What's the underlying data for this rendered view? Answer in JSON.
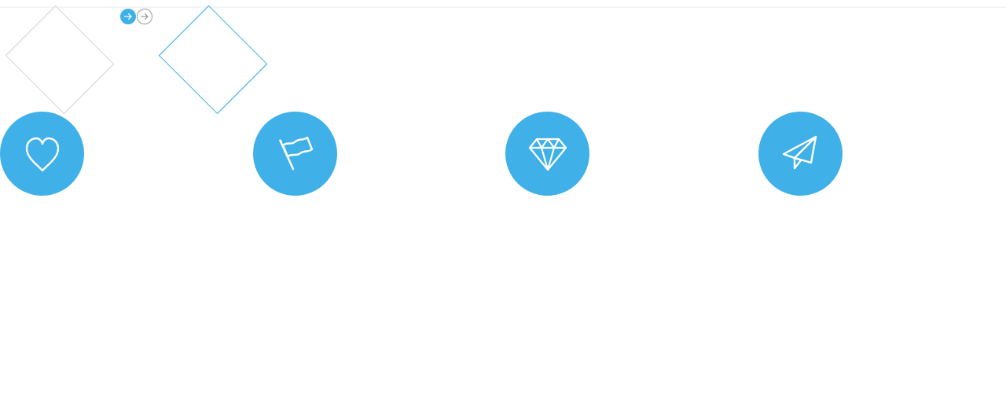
{
  "slider": {
    "controls": [
      {
        "id": "next-active",
        "icon": "arrow-right-icon",
        "state": "active"
      },
      {
        "id": "next-inactive",
        "icon": "arrow-right-icon",
        "state": "inactive"
      }
    ],
    "shapes": [
      {
        "id": "diamond-1",
        "color": "#d6d6d6"
      },
      {
        "id": "diamond-2",
        "color": "#3fb0e8"
      }
    ]
  },
  "features": [
    {
      "icon": "heart-icon"
    },
    {
      "icon": "flag-icon"
    },
    {
      "icon": "diamond-gem-icon"
    },
    {
      "icon": "paper-plane-icon"
    }
  ],
  "colors": {
    "accent": "#3fb0e8",
    "border_gray": "#d6d6d6",
    "icon_stroke": "#ffffff"
  }
}
